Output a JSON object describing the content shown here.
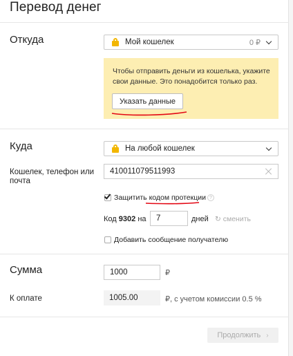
{
  "page": {
    "title": "Перевод денег"
  },
  "from": {
    "label": "Откуда",
    "wallet": {
      "name": "Мой кошелек",
      "balance": "0 ₽",
      "icon": "wallet-icon"
    },
    "notice": {
      "text": "Чтобы отправить деньги из кошелька, укажите свои данные. Это понадобится только раз.",
      "button": "Указать данные"
    }
  },
  "to": {
    "label": "Куда",
    "destination": {
      "name": "На любой кошелек",
      "icon": "wallet-icon"
    },
    "account_label": "Кошелек, телефон или почта",
    "account_value": "410011079511993",
    "protect": {
      "checked": true,
      "label_prefix": "Защитить ",
      "label_link": "кодом протекции",
      "help": "?"
    },
    "code": {
      "prefix": "Код",
      "value": "9302",
      "for": "на",
      "days": "7",
      "days_unit": "дней",
      "change": "сменить"
    },
    "message": {
      "checked": false,
      "label": "Добавить сообщение получателю"
    }
  },
  "sum": {
    "label": "Сумма",
    "amount": "1000",
    "currency": "₽",
    "payable_label": "К оплате",
    "payable_value": "1005.00",
    "payable_note": "₽, с учетом комиссии 0.5 %"
  },
  "actions": {
    "continue": "Продолжить",
    "continue_arrow": "›"
  },
  "colors": {
    "notice_bg": "#fdeeb2",
    "accent_yellow": "#f2b600",
    "red_mark": "#e30613"
  }
}
